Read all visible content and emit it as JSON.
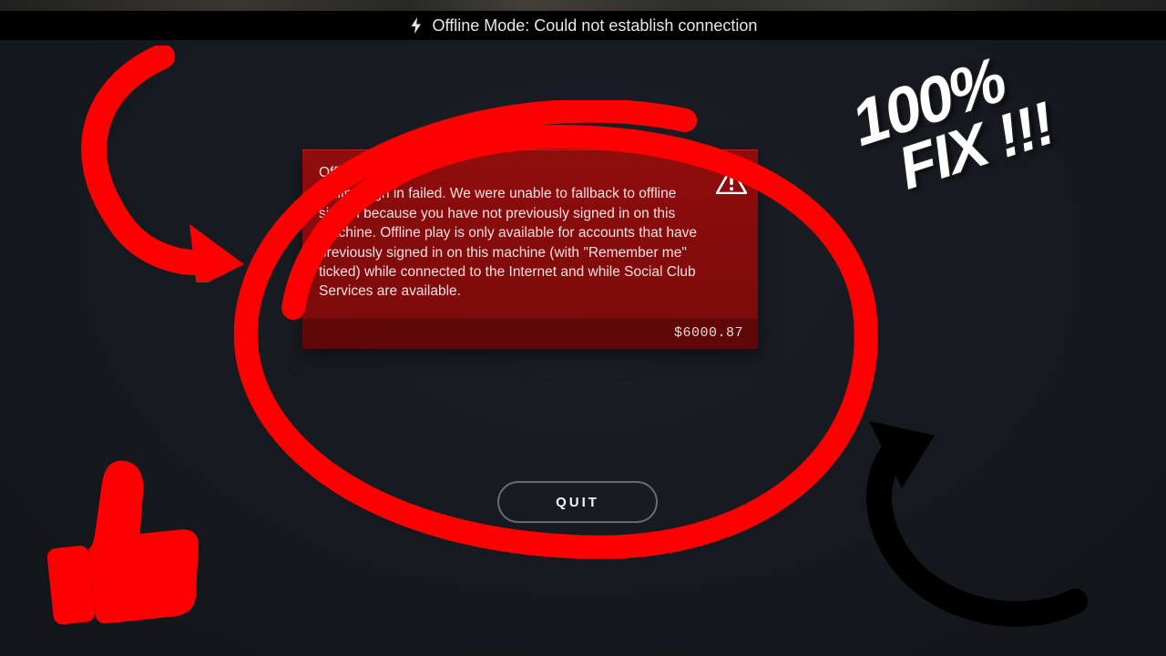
{
  "banner": {
    "text": "Offline Mode: Could not establish connection"
  },
  "error": {
    "title": "Offline",
    "body": "Online sign in failed. We were unable to fallback to offline sign in because you have not previously signed in on this machine. Offline play is only available for accounts that have previously signed in on this machine (with \"Remember me\" ticked) while connected to the Internet and while Social Club Services are available.",
    "code": "$6000.87"
  },
  "buttons": {
    "quit": "QUIT"
  },
  "overlay": {
    "fix_line1": "100%",
    "fix_line2": "FIX !!!"
  },
  "colors": {
    "accent_red": "#fe0000",
    "card_red": "#8f0d0d"
  }
}
